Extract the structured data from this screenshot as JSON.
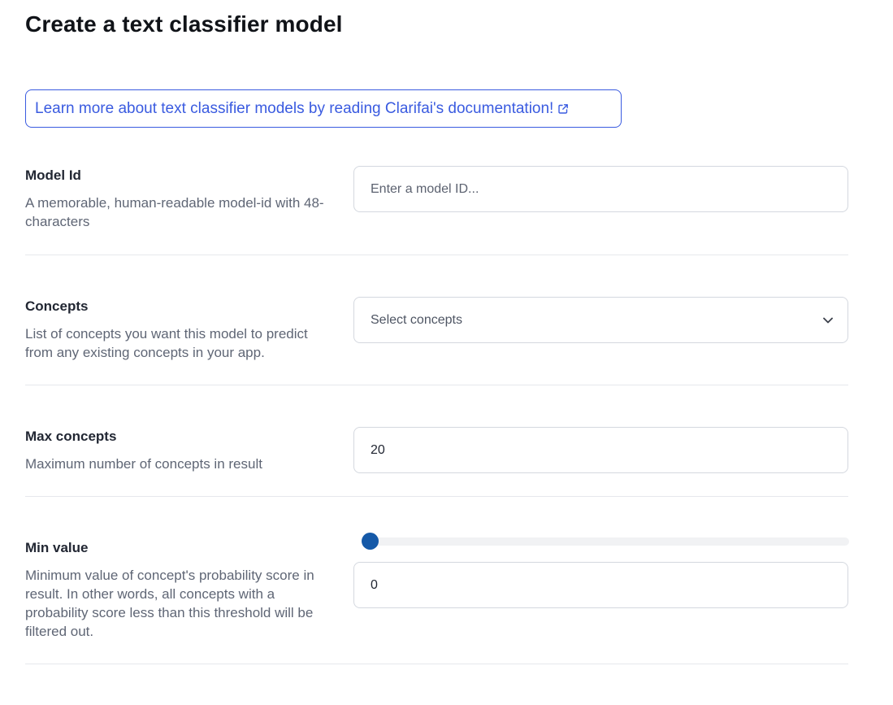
{
  "page": {
    "title": "Create a text classifier model"
  },
  "doc_link": {
    "text": "Learn more about text classifier models by reading Clarifai's documentation!",
    "icon": "external-link-icon",
    "color": "#3a5be0"
  },
  "fields": {
    "model_id": {
      "label": "Model Id",
      "description": "A memorable, human-readable model-id with 48-characters",
      "placeholder": "Enter a model ID...",
      "value": ""
    },
    "concepts": {
      "label": "Concepts",
      "description": "List of concepts you want this model to predict from any existing concepts in your app.",
      "placeholder": "Select concepts",
      "icon": "chevron-down-icon"
    },
    "max_concepts": {
      "label": "Max concepts",
      "description": "Maximum number of concepts in result",
      "value": "20"
    },
    "min_value": {
      "label": "Min value",
      "description": "Minimum value of concept's probability score in result. In other words, all concepts with a probability score less than this threshold will be filtered out.",
      "value": "0",
      "slider_fraction": 0
    }
  },
  "colors": {
    "accent": "#3a5be0",
    "slider_thumb": "#1559a8"
  }
}
